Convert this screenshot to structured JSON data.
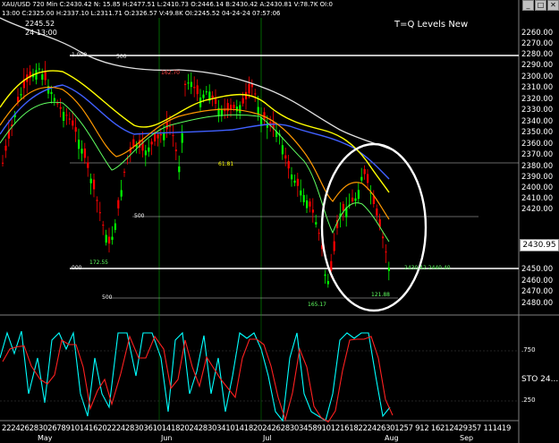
{
  "window": {
    "instrument_line": "XAU/USD 720 Min  C:2430.42  N:  15.85  H:2477.51  L:2410.73  O:2446.14  B:2430.42  A:2430.81  V:78.7K  OI:0",
    "ohlc_line": "13:00  C:2325.00  H:2337.10  L:2311.71  O:2326.57  V:49.8K  OI:2245.52  04-24-24  07:57:06",
    "cursor_value": "2245.52",
    "cursor_time": "24 13:00",
    "study_title": "T=Q Levels New",
    "controls": [
      "_",
      "□",
      "✕"
    ]
  },
  "price_axis": {
    "labels": [
      "2260.00",
      "2270.00",
      "2280.00",
      "2290.00",
      "2300.00",
      "2310.00",
      "2320.00",
      "2330.00",
      "2340.00",
      "2350.00",
      "2360.00",
      "2370.00",
      "2380.00",
      "2390.00",
      "2400.00",
      "2410.00",
      "2420.00",
      "2430.95",
      "2450.00",
      "2460.00",
      "2470.00",
      "2480.00"
    ],
    "last_price": "2430.95"
  },
  "level_labels": {
    "l1000": "1.000",
    "l500_top": "500",
    "l500_mid": "500",
    "l000": "000",
    "l500_bot": "500",
    "lvl_172": "172.55",
    "lvl_162": "162.70",
    "lvl_61": "61.81",
    "lvl_165": "165.17",
    "lvl_121": "121.88",
    "lvl_right": "2430.42 2440.40"
  },
  "oscillator": {
    "title": "STO  24...",
    "labels": [
      ".750",
      ".250"
    ]
  },
  "time_axis": {
    "day_ticks": "222426283026789101416202224283036101418202428303410141820242628303458910121618222426301257  912 16212429357 111419",
    "months": [
      "May",
      "Jun",
      "Jul",
      "Aug",
      "Sep"
    ]
  },
  "colors": {
    "background": "#000000",
    "candle_up": "#00ff00",
    "candle_down": "#ff0000",
    "ma_white": "#e0e0e0",
    "ma_blue": "#4060ff",
    "ma_yellow": "#ffff00",
    "ma_orange": "#ff9900",
    "stoch_fast": "#00ffff",
    "stoch_slow": "#ff0000"
  }
}
